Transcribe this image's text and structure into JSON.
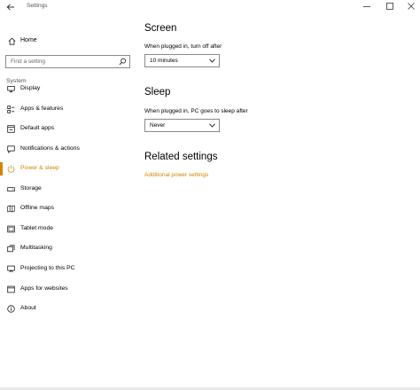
{
  "window": {
    "title": "Settings",
    "controls": {
      "minimize": "minimize-icon",
      "maximize": "maximize-icon",
      "close": "close-icon"
    }
  },
  "sidebar": {
    "home_label": "Home",
    "search_placeholder": "Find a setting",
    "section_label": "System",
    "items": [
      {
        "label": "Display",
        "icon": "display-icon",
        "active": false
      },
      {
        "label": "Apps & features",
        "icon": "apps-features-icon",
        "active": false
      },
      {
        "label": "Default apps",
        "icon": "default-apps-icon",
        "active": false
      },
      {
        "label": "Notifications & actions",
        "icon": "notifications-icon",
        "active": false
      },
      {
        "label": "Power & sleep",
        "icon": "power-icon",
        "active": true
      },
      {
        "label": "Storage",
        "icon": "storage-icon",
        "active": false
      },
      {
        "label": "Offline maps",
        "icon": "map-icon",
        "active": false
      },
      {
        "label": "Tablet mode",
        "icon": "tablet-icon",
        "active": false
      },
      {
        "label": "Multitasking",
        "icon": "multitasking-icon",
        "active": false
      },
      {
        "label": "Projecting to this PC",
        "icon": "projecting-icon",
        "active": false
      },
      {
        "label": "Apps for websites",
        "icon": "apps-websites-icon",
        "active": false
      },
      {
        "label": "About",
        "icon": "info-icon",
        "active": false
      }
    ]
  },
  "main": {
    "screen": {
      "heading": "Screen",
      "label": "When plugged in, turn off after",
      "value": "10 minutes"
    },
    "sleep": {
      "heading": "Sleep",
      "label": "When plugged in, PC goes to sleep after",
      "value": "Never"
    },
    "related": {
      "heading": "Related settings",
      "link": "Additional power settings"
    }
  },
  "colors": {
    "accent": "#d28400",
    "text": "#000000",
    "muted": "#555555",
    "border": "#8a8a8a",
    "background": "#ffffff"
  }
}
